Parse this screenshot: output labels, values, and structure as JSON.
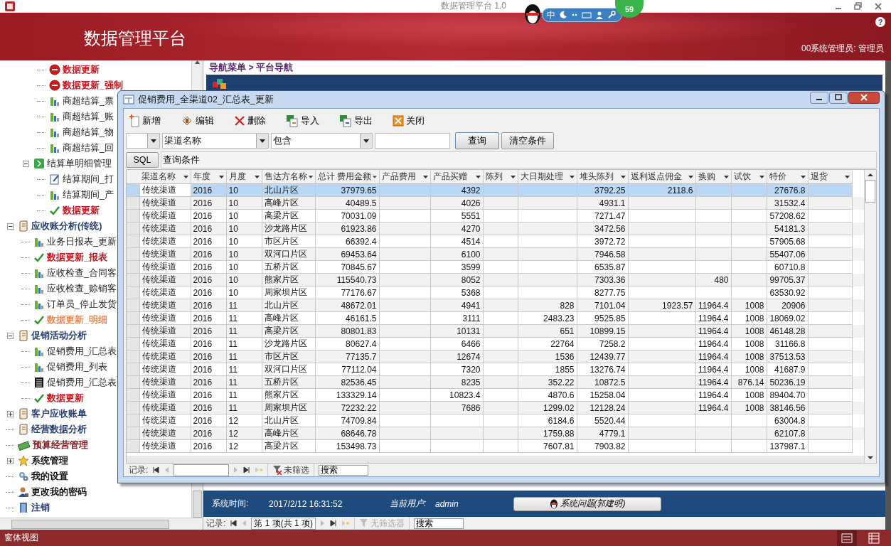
{
  "app": {
    "title": "数据管理平台 1.0"
  },
  "ime_bar": {
    "mode": "中",
    "badge": "59"
  },
  "header": {
    "title": "数据管理平台",
    "user": "00系统管理员: 管理员",
    "help": "?"
  },
  "sidebar": {
    "tree": [
      {
        "children": [
          {
            "children": [
              {
                "label": "数据更新",
                "kind": "stop",
                "color": "#c8141e",
                "bold": true
              },
              {
                "label": "数据更新_强制",
                "kind": "stop",
                "color": "#c8141e",
                "bold": true
              },
              {
                "label": "商超结算_票",
                "kind": "chart",
                "bold": false
              },
              {
                "label": "商超结算_账",
                "kind": "chart",
                "bold": false
              },
              {
                "label": "商超结算_物",
                "kind": "chart",
                "bold": false
              },
              {
                "label": "商超结算_回",
                "kind": "chart",
                "bold": false
              }
            ]
          },
          {
            "label": "结算单明细管理",
            "kind": "module",
            "bold": false,
            "expanded": true,
            "children": [
              {
                "label": "结算期间_打",
                "kind": "form",
                "bold": false
              },
              {
                "label": "结算期间_产",
                "kind": "chart",
                "bold": false
              },
              {
                "label": "数据更新",
                "kind": "check",
                "color": "#c8141e",
                "bold": true
              }
            ]
          }
        ]
      },
      {
        "label": "应收账分析(传统)",
        "kind": "scroll",
        "color": "#2a3d6e",
        "bold": true,
        "expanded": true,
        "children": [
          {
            "label": "业务日报表_更新",
            "kind": "chart",
            "bold": false
          },
          {
            "label": "数据更新_报表",
            "kind": "check",
            "color": "#c8141e",
            "bold": true
          },
          {
            "label": "应收检查_合同客",
            "kind": "chart",
            "bold": false
          },
          {
            "label": "应收检查_赊销客",
            "kind": "chart",
            "bold": false
          },
          {
            "label": "订单员_停止发货",
            "kind": "chart",
            "bold": false
          },
          {
            "label": "数据更新_明细",
            "kind": "check",
            "color": "#e8885a",
            "bold": true
          }
        ]
      },
      {
        "label": "促销活动分析",
        "kind": "scroll",
        "color": "#2a3d6e",
        "bold": true,
        "expanded": true,
        "children": [
          {
            "label": "促销费用_汇总表",
            "kind": "chart",
            "bold": false
          },
          {
            "label": "促销费用_列表",
            "kind": "chart",
            "bold": false
          },
          {
            "label": "促销费用_汇总表",
            "kind": "report",
            "bold": false
          },
          {
            "label": "数据更新",
            "kind": "check",
            "color": "#c8141e",
            "bold": true
          }
        ]
      },
      {
        "label": "客户应收账单",
        "kind": "scroll",
        "color": "#2a3d6e",
        "bold": true,
        "expanded": false
      },
      {
        "label": "经营数据分析",
        "kind": "scroll",
        "color": "#2a3d6e",
        "bold": true
      },
      {
        "label": "预算经营管理",
        "kind": "money",
        "color": "#7a1e22",
        "bold": true
      },
      {
        "label": "系统管理",
        "kind": "star",
        "color": "#111111",
        "bold": true,
        "expanded": false
      },
      {
        "label": "我的设置",
        "kind": "gears",
        "color": "#111111",
        "bold": true
      },
      {
        "label": "更改我的密码",
        "kind": "person",
        "color": "#111111",
        "bold": true
      },
      {
        "label": "注销",
        "kind": "door",
        "color": "#2a3d6e",
        "bold": true
      }
    ]
  },
  "breadcrumb": {
    "path": "导航菜单 > 平台导航"
  },
  "info_bar": {
    "time_label": "系统时间:",
    "time": "2017/2/12 16:31:52",
    "user_label": "当前用户:",
    "user": "admin",
    "support_button": "系统问题(郭建明)"
  },
  "main_nav": {
    "label": "记录:",
    "position": "第 1 项(共 1 项)",
    "filter": "无筛选器",
    "filter_disabled": true,
    "search": "搜索"
  },
  "dialog": {
    "title": "促销费用_全渠道02_汇总表_更新",
    "toolbar": [
      {
        "label": "新增",
        "kind": "new"
      },
      {
        "label": "编辑",
        "kind": "edit"
      },
      {
        "label": "删除",
        "kind": "delete"
      },
      {
        "label": "导入",
        "kind": "import"
      },
      {
        "label": "导出",
        "kind": "export"
      },
      {
        "label": "关闭",
        "kind": "close"
      }
    ],
    "filter": {
      "field": "渠道名称",
      "operator": "包含",
      "query_button": "查询",
      "clear_button": "清空条件",
      "sql_button": "SQL",
      "condition": "查询条件"
    },
    "table": {
      "columns": [
        "渠道名称",
        "年度",
        "月度",
        "售达方名称",
        "总计 费用金额",
        "产品费用",
        "产品买赠",
        "陈列",
        "大日期处理",
        "堆头陈列",
        "返利返点佣金",
        "换购",
        "试饮",
        "特价",
        "退货"
      ],
      "rows": [
        {
          "selected": true,
          "cells": [
            "传统渠道",
            "2016",
            "10",
            "北山片区",
            "37979.65",
            null,
            "4392",
            null,
            null,
            "3792.25",
            "2118.6",
            null,
            null,
            "27676.8",
            null
          ]
        },
        {
          "selected": false,
          "cells": [
            "传统渠道",
            "2016",
            "10",
            "高峰片区",
            "40489.5",
            null,
            "4026",
            null,
            null,
            "4931.1",
            null,
            null,
            null,
            "31532.4",
            null
          ]
        },
        {
          "selected": false,
          "cells": [
            "传统渠道",
            "2016",
            "10",
            "高梁片区",
            "70031.09",
            null,
            "5551",
            null,
            null,
            "7271.47",
            null,
            null,
            null,
            "57208.62",
            null
          ]
        },
        {
          "selected": false,
          "cells": [
            "传统渠道",
            "2016",
            "10",
            "沙龙路片区",
            "61923.86",
            null,
            "4270",
            null,
            null,
            "3472.56",
            null,
            null,
            null,
            "54181.3",
            null
          ]
        },
        {
          "selected": false,
          "cells": [
            "传统渠道",
            "2016",
            "10",
            "市区片区",
            "66392.4",
            null,
            "4514",
            null,
            null,
            "3972.72",
            null,
            null,
            null,
            "57905.68",
            null
          ]
        },
        {
          "selected": false,
          "cells": [
            "传统渠道",
            "2016",
            "10",
            "双河口片区",
            "69453.64",
            null,
            "6100",
            null,
            null,
            "7946.58",
            null,
            null,
            null,
            "55407.06",
            null
          ]
        },
        {
          "selected": false,
          "cells": [
            "传统渠道",
            "2016",
            "10",
            "五桥片区",
            "70845.67",
            null,
            "3599",
            null,
            null,
            "6535.87",
            null,
            null,
            null,
            "60710.8",
            null
          ]
        },
        {
          "selected": false,
          "cells": [
            "传统渠道",
            "2016",
            "10",
            "熊家片区",
            "115540.73",
            null,
            "8052",
            null,
            null,
            "7303.36",
            null,
            "480",
            null,
            "99705.37",
            null
          ]
        },
        {
          "selected": false,
          "cells": [
            "传统渠道",
            "2016",
            "10",
            "周家坝片区",
            "77176.67",
            null,
            "5368",
            null,
            null,
            "8277.75",
            null,
            null,
            null,
            "63530.92",
            null
          ]
        },
        {
          "selected": false,
          "cells": [
            "传统渠道",
            "2016",
            "11",
            "北山片区",
            "48672.01",
            null,
            "4941",
            null,
            "828",
            "7101.04",
            "1923.57",
            "11964.4",
            "1008",
            "20906",
            null
          ]
        },
        {
          "selected": false,
          "cells": [
            "传统渠道",
            "2016",
            "11",
            "高峰片区",
            "46161.5",
            null,
            "3111",
            null,
            "2483.23",
            "9525.85",
            null,
            "11964.4",
            "1008",
            "18069.02",
            null
          ]
        },
        {
          "selected": false,
          "cells": [
            "传统渠道",
            "2016",
            "11",
            "高梁片区",
            "80801.83",
            null,
            "10131",
            null,
            "651",
            "10899.15",
            null,
            "11964.4",
            "1008",
            "46148.28",
            null
          ]
        },
        {
          "selected": false,
          "cells": [
            "传统渠道",
            "2016",
            "11",
            "沙龙路片区",
            "80627.4",
            null,
            "6466",
            null,
            "22764",
            "7258.2",
            null,
            "11964.4",
            "1008",
            "31166.8",
            null
          ]
        },
        {
          "selected": false,
          "cells": [
            "传统渠道",
            "2016",
            "11",
            "市区片区",
            "77135.7",
            null,
            "12674",
            null,
            "1536",
            "12439.77",
            null,
            "11964.4",
            "1008",
            "37513.53",
            null
          ]
        },
        {
          "selected": false,
          "cells": [
            "传统渠道",
            "2016",
            "11",
            "双河口片区",
            "77112.04",
            null,
            "7320",
            null,
            "1855",
            "13276.74",
            null,
            "11964.4",
            "1008",
            "41687.9",
            null
          ]
        },
        {
          "selected": false,
          "cells": [
            "传统渠道",
            "2016",
            "11",
            "五桥片区",
            "82536.45",
            null,
            "8235",
            null,
            "352.22",
            "10872.5",
            null,
            "11964.4",
            "876.14",
            "50236.19",
            null
          ]
        },
        {
          "selected": false,
          "cells": [
            "传统渠道",
            "2016",
            "11",
            "熊家片区",
            "133329.14",
            null,
            "10823.4",
            null,
            "4870.6",
            "15258.04",
            null,
            "11964.4",
            "1008",
            "89404.70",
            null
          ]
        },
        {
          "selected": false,
          "cells": [
            "传统渠道",
            "2016",
            "11",
            "周家坝片区",
            "72232.22",
            null,
            "7686",
            null,
            "1299.02",
            "12128.24",
            null,
            "11964.4",
            "1008",
            "38146.56",
            null
          ]
        },
        {
          "selected": false,
          "cells": [
            "传统渠道",
            "2016",
            "12",
            "北山片区",
            "74709.84",
            null,
            null,
            null,
            "6184.6",
            "5520.44",
            null,
            null,
            null,
            "63004.8",
            null
          ]
        },
        {
          "selected": false,
          "cells": [
            "传统渠道",
            "2016",
            "12",
            "高峰片区",
            "68646.78",
            null,
            null,
            null,
            "1759.88",
            "4779.1",
            null,
            null,
            null,
            "62107.8",
            null
          ]
        },
        {
          "selected": false,
          "cells": [
            "传统渠道",
            "2016",
            "12",
            "高梁片区",
            "153498.73",
            null,
            null,
            null,
            "7607.81",
            "7903.82",
            null,
            null,
            null,
            "137987.1",
            null
          ]
        }
      ]
    },
    "nav": {
      "label": "记录:",
      "filter": "未筛选",
      "filter_disabled": false,
      "search": "搜索"
    }
  },
  "status_bar": {
    "text": "窗体视图"
  }
}
